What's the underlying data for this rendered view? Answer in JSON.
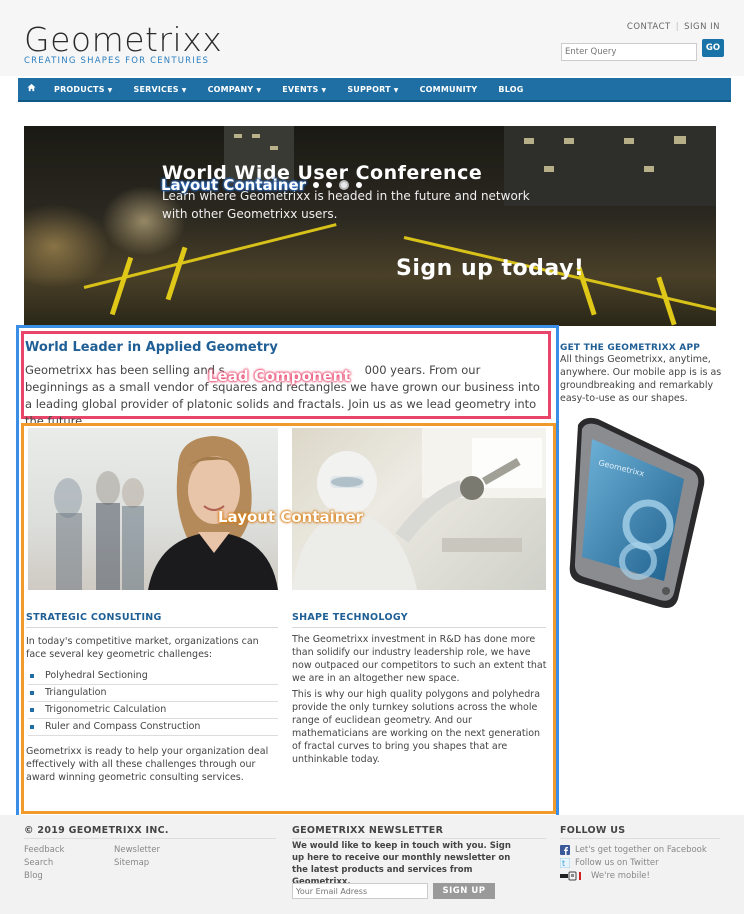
{
  "header": {
    "logo_title": "Geometrixx",
    "logo_tagline": "CREATING SHAPES FOR CENTURIES",
    "top_links": [
      "CONTACT",
      "SIGN IN"
    ],
    "search_placeholder": "Enter Query",
    "search_button": "GO"
  },
  "nav": {
    "home_icon": "home-icon",
    "items": [
      {
        "label": "PRODUCTS",
        "has_dropdown": true
      },
      {
        "label": "SERVICES",
        "has_dropdown": true
      },
      {
        "label": "COMPANY",
        "has_dropdown": true
      },
      {
        "label": "EVENTS",
        "has_dropdown": true
      },
      {
        "label": "SUPPORT",
        "has_dropdown": true
      },
      {
        "label": "COMMUNITY",
        "has_dropdown": false
      },
      {
        "label": "BLOG",
        "has_dropdown": false
      }
    ],
    "caret": "▼"
  },
  "hero": {
    "title": "World Wide User Conference",
    "subtitle": "Learn where Geometrixx is headed in the future and network with other Geometrixx users.",
    "cta": "Sign up today!",
    "overlay_label": "Layout Container",
    "active_slide": 3,
    "slide_count": 4
  },
  "lead": {
    "title": "World Leader in Applied Geometry",
    "text_before": "Geometrixx has been selling and s",
    "text_after": "000 years. From our beginnings as a small vendor of squares and rectangles we have grown our business into a leading global provider of platonic solids and fractals. Join us as we lead geometry into the future.",
    "overlay_label": "Lead Component"
  },
  "container": {
    "overlay_label": "Layout Container"
  },
  "strategic": {
    "title": "STRATEGIC CONSULTING",
    "intro": "In today's competitive market, organizations can face several key geometric challenges:",
    "bullets": [
      "Polyhedral Sectioning",
      "Triangulation",
      "Trigonometric Calculation",
      "Ruler and Compass Construction"
    ],
    "outro": "Geometrixx is ready to help your organization deal effectively with all these challenges through our award winning geometric consulting services."
  },
  "shape": {
    "title": "SHAPE TECHNOLOGY",
    "para1": "The Geometrixx investment in R&D has done more than solidify our industry leadership role, we have now outpaced our competitors to such an extent that we are in an altogether new space.",
    "para2": "This is why our high quality polygons and polyhedra provide the only turnkey solutions across the whole range of euclidean geometry. And our mathematicians are working on the next generation of fractal curves to bring you shapes that are unthinkable today."
  },
  "app": {
    "title": "GET THE GEOMETRIXX APP",
    "text": "All things Geometrixx, anytime, anywhere. Our mobile app is is as groundbreaking and remarkably easy-to-use as our shapes.",
    "phone_brand": "Geometrixx"
  },
  "footer": {
    "copyright": "© 2019 GEOMETRIXX INC.",
    "links_col1": [
      "Feedback",
      "Search",
      "Blog"
    ],
    "links_col2": [
      "Newsletter",
      "Sitemap"
    ],
    "newsletter_title": "GEOMETRIXX NEWSLETTER",
    "newsletter_text": "We would like to keep in touch with you. Sign up here to receive our monthly newsletter on the latest products and services from Geometrixx.",
    "email_placeholder": "Your Email Adress",
    "signup_button": "SIGN UP",
    "follow_title": "FOLLOW US",
    "follow_items": [
      {
        "icon": "facebook-icon",
        "label": "Let's get together on Facebook"
      },
      {
        "icon": "twitter-icon",
        "label": "Follow us on Twitter"
      },
      {
        "icon": "mobile-icon",
        "label": "We're mobile!"
      }
    ]
  },
  "colors": {
    "brand_blue": "#1f6fa5",
    "heading_blue": "#1f5f95",
    "outline_blue": "#3a8ee6",
    "outline_pink": "#e9446a",
    "outline_orange": "#f09a2b"
  }
}
